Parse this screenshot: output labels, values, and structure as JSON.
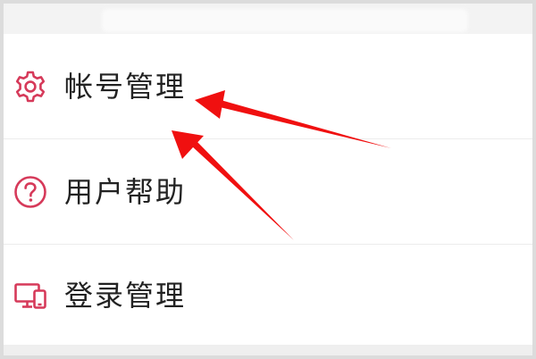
{
  "menu": {
    "items": [
      {
        "label": "帐号管理",
        "icon": "gear-icon"
      },
      {
        "label": "用户帮助",
        "icon": "question-circle-icon"
      },
      {
        "label": "登录管理",
        "icon": "devices-icon"
      }
    ]
  },
  "colors": {
    "icon": "#d63a5a",
    "arrow": "#f01010",
    "text": "#222222"
  }
}
